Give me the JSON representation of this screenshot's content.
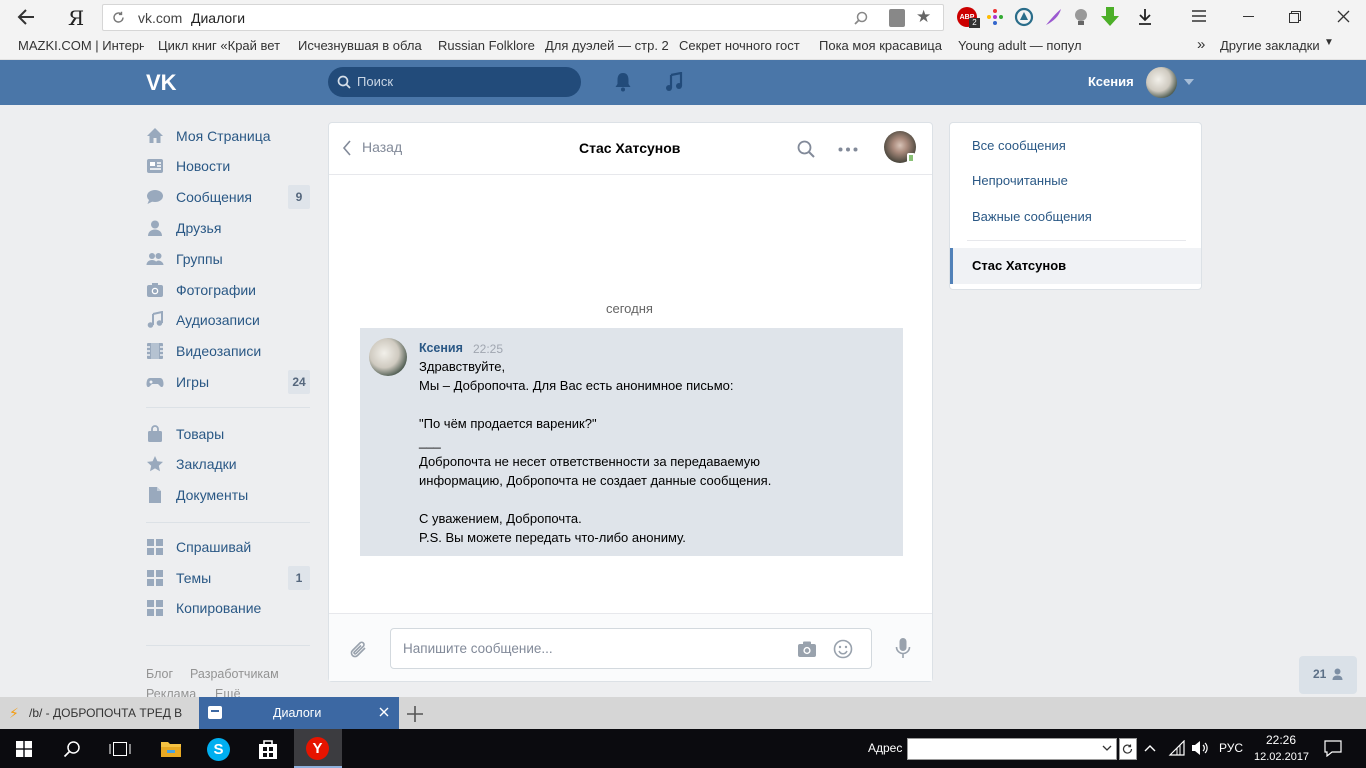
{
  "browser": {
    "back_icon": "back-arrow-icon",
    "yandex_logo": "Я",
    "url_domain": "vk.com",
    "url_title": "Диалоги",
    "bookmarks": [
      "MAZKI.COM | Интерн",
      "Цикл книг «Край вет",
      "Исчезнувшая в обла",
      "Russian Folklore",
      "Для дуэлей — стр. 2",
      "Секрет ночного гост",
      "Пока моя красавица",
      "Young adult — попул"
    ],
    "bookmarks_more": "»",
    "other_bookmarks": "Другие закладки",
    "abp_badge": "2"
  },
  "header": {
    "search_placeholder": "Поиск",
    "user_name": "Ксения"
  },
  "menu": {
    "items": [
      {
        "label": "Моя Страница",
        "badge": ""
      },
      {
        "label": "Новости",
        "badge": ""
      },
      {
        "label": "Сообщения",
        "badge": "9"
      },
      {
        "label": "Друзья",
        "badge": ""
      },
      {
        "label": "Группы",
        "badge": ""
      },
      {
        "label": "Фотографии",
        "badge": ""
      },
      {
        "label": "Аудиозаписи",
        "badge": ""
      },
      {
        "label": "Видеозаписи",
        "badge": ""
      },
      {
        "label": "Игры",
        "badge": "24"
      },
      {
        "label": "Товары",
        "badge": ""
      },
      {
        "label": "Закладки",
        "badge": ""
      },
      {
        "label": "Документы",
        "badge": ""
      },
      {
        "label": "Спрашивай",
        "badge": ""
      },
      {
        "label": "Темы",
        "badge": "1"
      },
      {
        "label": "Копирование",
        "badge": ""
      }
    ],
    "footer": [
      "Блог",
      "Разработчикам",
      "Реклама",
      "Ещё"
    ]
  },
  "dialog": {
    "back_label": "Назад",
    "title": "Стас Хатсунов",
    "date_label": "сегодня",
    "message": {
      "author": "Ксения",
      "time": "22:25",
      "lines": [
        "Здравствуйте,",
        "Мы – Добропочта. Для Вас есть анонимное письмо:",
        "",
        "\"По чём продается вареник?\"",
        "___",
        "Добропочта не несет ответственности за передаваемую",
        "информацию, Добропочта не создает данные сообщения.",
        "",
        "С уважением, Добропочта.",
        "P.S. Вы можете передать что-либо анониму."
      ]
    },
    "input_placeholder": "Напишите сообщение..."
  },
  "rightpanel": {
    "items": [
      "Все сообщения",
      "Непрочитанные",
      "Важные сообщения"
    ],
    "active": "Стас Хатсунов"
  },
  "online_count": "21",
  "tabs": [
    {
      "title": "/b/ - ДОБРОПОЧТА ТРЕД В"
    },
    {
      "title": "Диалоги"
    }
  ],
  "taskbar": {
    "address_label": "Адрес",
    "language": "РУС",
    "time": "22:26",
    "date": "12.02.2017"
  },
  "colors": {
    "vk_header": "#4a76a8",
    "link": "#2a5885",
    "message_bg": "#dfe4ea",
    "page_bg": "#edeef0"
  }
}
